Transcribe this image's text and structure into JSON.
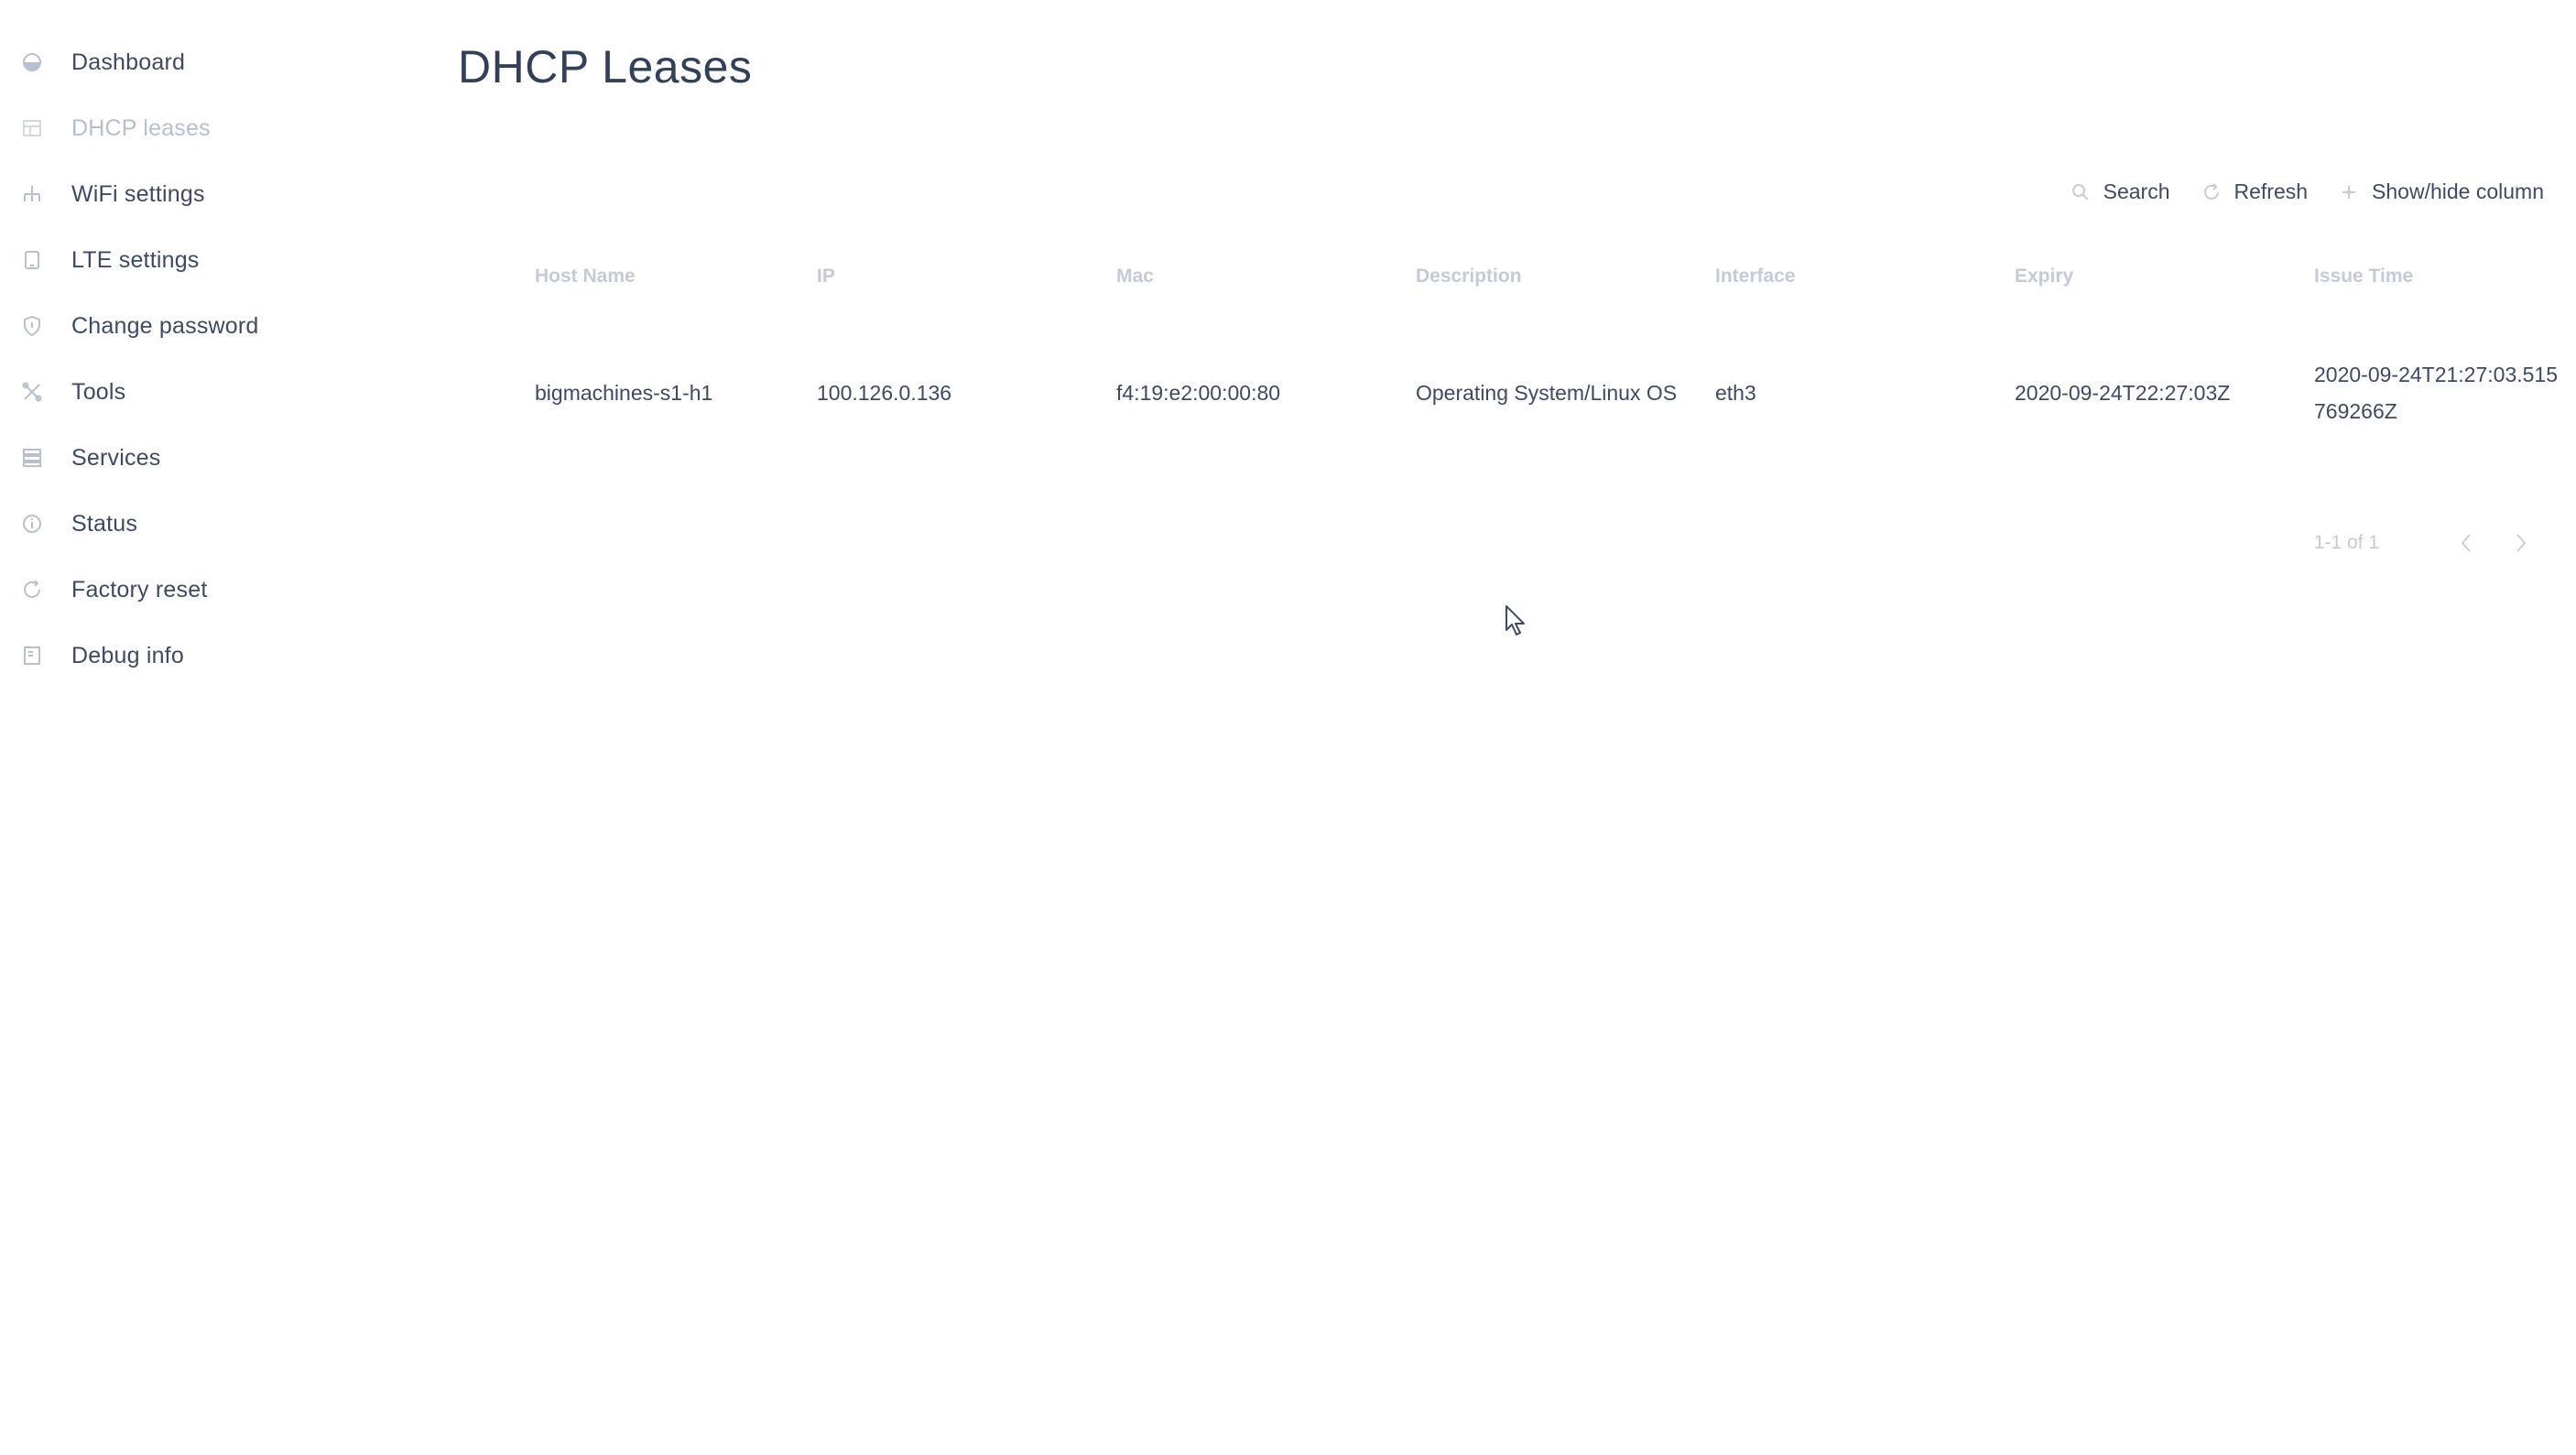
{
  "sidebar": {
    "items": [
      {
        "label": "Dashboard",
        "icon": "dashboard-icon"
      },
      {
        "label": "DHCP leases",
        "icon": "table-icon",
        "active": true
      },
      {
        "label": "WiFi settings",
        "icon": "network-icon"
      },
      {
        "label": "LTE settings",
        "icon": "tablet-icon"
      },
      {
        "label": "Change password",
        "icon": "shield-icon"
      },
      {
        "label": "Tools",
        "icon": "tools-icon"
      },
      {
        "label": "Services",
        "icon": "services-icon"
      },
      {
        "label": "Status",
        "icon": "info-icon"
      },
      {
        "label": "Factory reset",
        "icon": "reset-icon"
      },
      {
        "label": "Debug info",
        "icon": "document-icon"
      }
    ]
  },
  "main": {
    "title": "DHCP Leases",
    "toolbar": {
      "search_label": "Search",
      "refresh_label": "Refresh",
      "columns_label": "Show/hide column"
    },
    "table": {
      "columns": [
        "Host Name",
        "IP",
        "Mac",
        "Description",
        "Interface",
        "Expiry",
        "Issue Time"
      ],
      "rows": [
        [
          "bigmachines-s1-h1",
          "100.126.0.136",
          "f4:19:e2:00:00:80",
          "Operating System/Linux OS",
          "eth3",
          "2020-09-24T22:27:03Z",
          "2020-09-24T21:27:03.515769266Z"
        ]
      ]
    },
    "pagination": {
      "range": "1-1 of 1"
    },
    "colors": {
      "text": "#3e4a63",
      "muted": "#c4cad6",
      "title": "#33405a"
    }
  }
}
